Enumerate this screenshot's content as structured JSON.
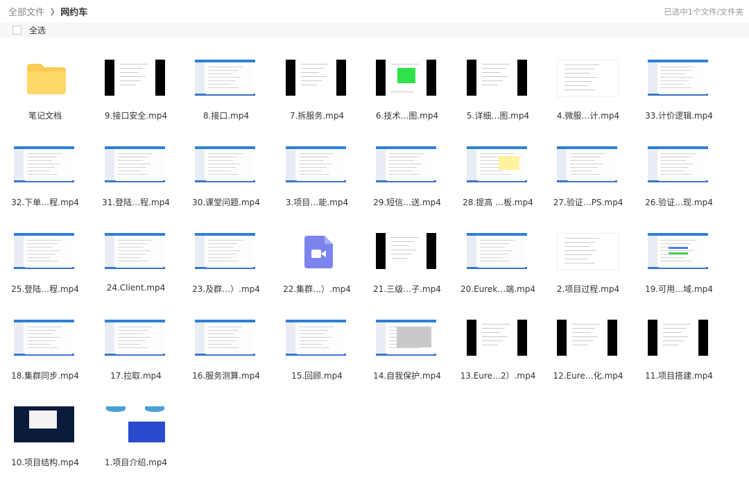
{
  "breadcrumb": {
    "root": "全部文件",
    "current": "网约车"
  },
  "selection_status": "已选中1个文件/文件夹",
  "toolbar": {
    "select_all_label": "全选"
  },
  "colors": {
    "folder": "#FCCB55",
    "video_doc": "#7B84EE"
  },
  "files": [
    {
      "name": "笔记文档",
      "icon": "folder-icon"
    },
    {
      "name": "9.接口安全.mp4",
      "icon": "video-thumbnail"
    },
    {
      "name": "8.接口.mp4",
      "icon": "video-thumbnail"
    },
    {
      "name": "7.拆服务.mp4",
      "icon": "video-thumbnail"
    },
    {
      "name": "6.技术…图.mp4",
      "icon": "video-thumbnail"
    },
    {
      "name": "5.详细…图.mp4",
      "icon": "video-thumbnail"
    },
    {
      "name": "4.微服…计.mp4",
      "icon": "video-thumbnail"
    },
    {
      "name": "33.计价逻辑.mp4",
      "icon": "video-thumbnail"
    },
    {
      "name": "32.下单…程.mp4",
      "icon": "video-thumbnail"
    },
    {
      "name": "31.登陆…程.mp4",
      "icon": "video-thumbnail"
    },
    {
      "name": "30.课堂问题.mp4",
      "icon": "video-thumbnail"
    },
    {
      "name": "3.项目…能.mp4",
      "icon": "video-thumbnail"
    },
    {
      "name": "29.短信…送.mp4",
      "icon": "video-thumbnail"
    },
    {
      "name": "28.提高 …板.mp4",
      "icon": "video-thumbnail"
    },
    {
      "name": "27.验证…PS.mp4",
      "icon": "video-thumbnail"
    },
    {
      "name": "26.验证…现.mp4",
      "icon": "video-thumbnail"
    },
    {
      "name": "25.登陆…程.mp4",
      "icon": "video-thumbnail"
    },
    {
      "name": "24.Client.mp4",
      "icon": "video-thumbnail"
    },
    {
      "name": "23.及群…）.mp4",
      "icon": "video-thumbnail"
    },
    {
      "name": "22.集群…）.mp4",
      "icon": "video-file-icon"
    },
    {
      "name": "21.三级…子.mp4",
      "icon": "video-thumbnail"
    },
    {
      "name": "20.Eurek…端.mp4",
      "icon": "video-thumbnail"
    },
    {
      "name": "2.项目过程.mp4",
      "icon": "video-thumbnail"
    },
    {
      "name": "19.可用…域.mp4",
      "icon": "video-thumbnail"
    },
    {
      "name": "18.集群同步.mp4",
      "icon": "video-thumbnail"
    },
    {
      "name": "17.拉取.mp4",
      "icon": "video-thumbnail"
    },
    {
      "name": "16.服务测算.mp4",
      "icon": "video-thumbnail"
    },
    {
      "name": "15.回顾.mp4",
      "icon": "video-thumbnail"
    },
    {
      "name": "14.自我保护.mp4",
      "icon": "video-thumbnail"
    },
    {
      "name": "13.Eure…2）.mp4",
      "icon": "video-thumbnail"
    },
    {
      "name": "12.Eure…化.mp4",
      "icon": "video-thumbnail"
    },
    {
      "name": "11.项目搭建.mp4",
      "icon": "video-thumbnail"
    },
    {
      "name": "10.项目结构.mp4",
      "icon": "video-thumbnail"
    },
    {
      "name": "1.项目介绍.mp4",
      "icon": "video-thumbnail"
    }
  ]
}
